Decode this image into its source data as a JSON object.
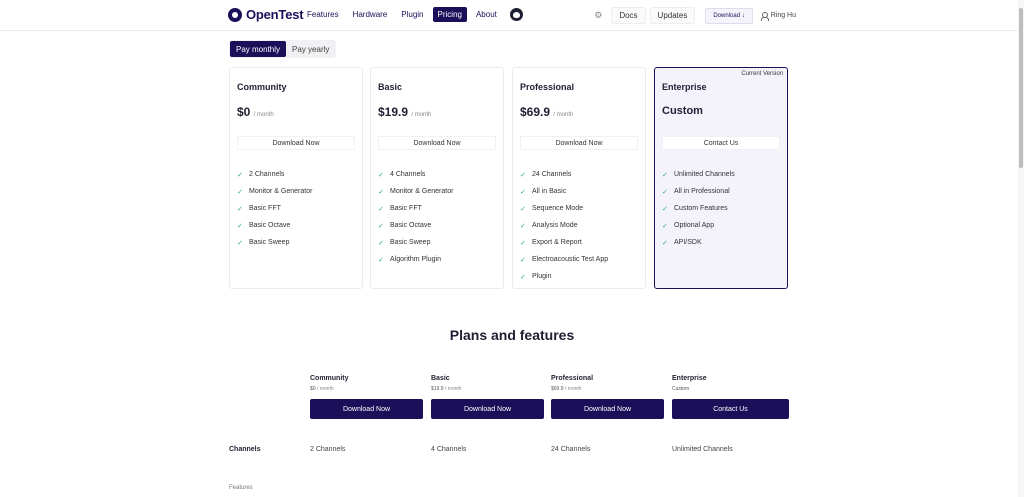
{
  "header": {
    "logo_text": "OpenTest",
    "nav": [
      "Features",
      "Hardware",
      "Plugin",
      "Pricing",
      "About"
    ],
    "active_nav": "Pricing",
    "right_tabs": [
      "Docs",
      "Updates"
    ],
    "download_label": "Download ↓",
    "user_name": "Ring Hu"
  },
  "billing": {
    "options": [
      "Pay monthly",
      "Pay yearly"
    ],
    "selected": "Pay monthly"
  },
  "plans": [
    {
      "name": "Community",
      "price": "$0",
      "per": "/ month",
      "button": "Download Now",
      "features": [
        "2 Channels",
        "Monitor & Generator",
        "Basic FFT",
        "Basic Octave",
        "Basic Sweep"
      ]
    },
    {
      "name": "Basic",
      "price": "$19.9",
      "per": "/ month",
      "button": "Download Now",
      "features": [
        "4 Channels",
        "Monitor & Generator",
        "Basic FFT",
        "Basic Octave",
        "Basic Sweep",
        "Algorithm Plugin"
      ]
    },
    {
      "name": "Professional",
      "price": "$69.9",
      "per": "/ month",
      "button": "Download Now",
      "features": [
        "24 Channels",
        "All in Basic",
        "Sequence Mode",
        "Analysis Mode",
        "Export & Report",
        "Electroacoustic Test App",
        "Plugin"
      ]
    },
    {
      "name": "Enterprise",
      "price": "Custom",
      "per": "",
      "button": "Contact Us",
      "badge": "Current Version",
      "features": [
        "Unlimited Channels",
        "All in Professional",
        "Custom Features",
        "Optional App",
        "API/SDK"
      ]
    }
  ],
  "comparison": {
    "title": "Plans and features",
    "columns": [
      {
        "name": "Community",
        "price": "$0",
        "per": "/ month",
        "button": "Download Now"
      },
      {
        "name": "Basic",
        "price": "$19.9",
        "per": "/ month",
        "button": "Download Now"
      },
      {
        "name": "Professional",
        "price": "$69.9",
        "per": "/ month",
        "button": "Download Now"
      },
      {
        "name": "Enterprise",
        "price": "Custom",
        "per": "",
        "button": "Contact Us"
      }
    ],
    "rows": [
      {
        "label": "Channels",
        "values": [
          "2 Channels",
          "4 Channels",
          "24 Channels",
          "Unlimited Channels"
        ]
      }
    ],
    "features_heading": "Features"
  },
  "colors": {
    "brand": "#1b0f5a",
    "check": "#2fae62",
    "enterprise_bg": "#f4f2fb"
  }
}
